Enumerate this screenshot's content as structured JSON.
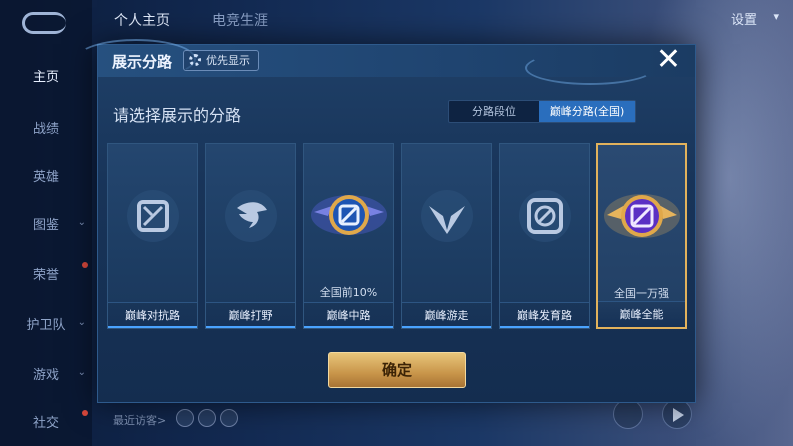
{
  "sidebar": {
    "items": [
      {
        "label": "主页",
        "active": true,
        "has_dot": false,
        "has_chevron": false
      },
      {
        "label": "战绩",
        "active": false,
        "has_dot": false,
        "has_chevron": false
      },
      {
        "label": "英雄",
        "active": false,
        "has_dot": false,
        "has_chevron": false
      },
      {
        "label": "图鉴",
        "active": false,
        "has_dot": false,
        "has_chevron": true
      },
      {
        "label": "荣誉",
        "active": false,
        "has_dot": true,
        "has_chevron": false
      },
      {
        "label": "护卫队",
        "active": false,
        "has_dot": false,
        "has_chevron": true
      },
      {
        "label": "游戏",
        "active": false,
        "has_dot": false,
        "has_chevron": true
      },
      {
        "label": "社交",
        "active": false,
        "has_dot": true,
        "has_chevron": true
      }
    ]
  },
  "topbar": {
    "tabs": [
      "个人主页",
      "电竞生涯"
    ],
    "active_tab": 0,
    "settings_label": "设置"
  },
  "modal": {
    "title": "展示分路",
    "priority_button": "优先显示",
    "subtitle": "请选择展示的分路",
    "segmented": [
      "分路段位",
      "巅峰分路(全国)"
    ],
    "segmented_active": 1,
    "cards": [
      {
        "label": "巅峰对抗路",
        "rank": "",
        "icon": "crossed-swords-icon",
        "highlight": false,
        "selected": false
      },
      {
        "label": "巅峰打野",
        "rank": "",
        "icon": "dragon-icon",
        "highlight": false,
        "selected": false
      },
      {
        "label": "巅峰中路",
        "rank": "全国前10%",
        "icon": "mid-lane-icon",
        "highlight": true,
        "selected": false
      },
      {
        "label": "巅峰游走",
        "rank": "",
        "icon": "wings-icon",
        "highlight": false,
        "selected": false
      },
      {
        "label": "巅峰发育路",
        "rank": "",
        "icon": "target-icon",
        "highlight": false,
        "selected": false
      },
      {
        "label": "巅峰全能",
        "rank": "全国一万强",
        "icon": "all-round-icon",
        "highlight": true,
        "selected": true
      }
    ],
    "confirm_label": "确定"
  },
  "bottom": {
    "recent_visitors_label": "最近访客>"
  },
  "colors": {
    "accent_blue": "#2a6ebd",
    "gold": "#e2b25c",
    "purple_gem": "#6b3bd6"
  }
}
